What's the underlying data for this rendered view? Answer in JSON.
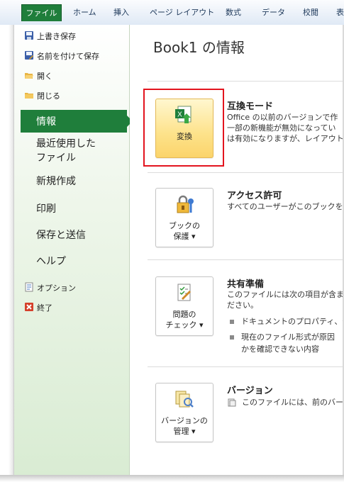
{
  "ribbon": {
    "tabs": [
      {
        "label": "ファイル",
        "active": true
      },
      {
        "label": "ホーム"
      },
      {
        "label": "挿入"
      },
      {
        "label": "ページ レイアウト"
      },
      {
        "label": "数式"
      },
      {
        "label": "データ"
      },
      {
        "label": "校閲"
      },
      {
        "label": "表"
      }
    ]
  },
  "nav": {
    "commands_top": [
      {
        "label": "上書き保存",
        "icon": "save-icon"
      },
      {
        "label": "名前を付けて保存",
        "icon": "save-as-icon"
      },
      {
        "label": "開く",
        "icon": "open-folder-icon"
      },
      {
        "label": "閉じる",
        "icon": "close-folder-icon"
      }
    ],
    "tabs": [
      {
        "label": "情報",
        "active": true
      },
      {
        "label": "最近使用した\nファイル"
      },
      {
        "label": "新規作成"
      },
      {
        "label": "印刷"
      },
      {
        "label": "保存と送信"
      },
      {
        "label": "ヘルプ"
      }
    ],
    "commands_bottom": [
      {
        "label": "オプション",
        "icon": "options-icon"
      },
      {
        "label": "終了",
        "icon": "exit-icon"
      }
    ]
  },
  "main": {
    "title": "Book1 の情報",
    "sections": {
      "compat": {
        "button": "変換",
        "heading": "互換モード",
        "lines": [
          "Office の以前のバージョンで作",
          "一部の新機能が無効になってい",
          "は有効になりますが、レイアウトの"
        ]
      },
      "permissions": {
        "button_line1": "ブックの",
        "button_line2": "保護 ▾",
        "heading": "アクセス許可",
        "lines": [
          "すべてのユーザーがこのブックを開"
        ]
      },
      "prepare": {
        "button_line1": "問題の",
        "button_line2": "チェック ▾",
        "heading": "共有準備",
        "lines": [
          "このファイルには次の項目が含ま",
          "ださい。"
        ],
        "bullets": [
          "ドキュメントのプロパティ、作",
          "現在のファイル形式が原因"
        ],
        "bullet_cont": "かを確認できない内容"
      },
      "versions": {
        "button_line1": "バージョンの",
        "button_line2": "管理 ▾",
        "heading": "バージョン",
        "lines": [
          "このファイルには、前のバージ"
        ]
      }
    }
  },
  "colors": {
    "file_tab": "#1f7e3b",
    "highlight_border": "#e3141e",
    "convert_button": "#fde28a"
  }
}
